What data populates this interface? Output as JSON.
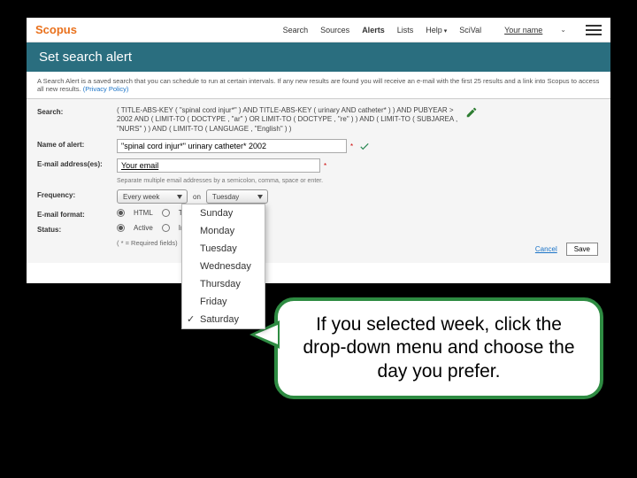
{
  "logo": "Scopus",
  "nav": {
    "search": "Search",
    "sources": "Sources",
    "alerts": "Alerts",
    "lists": "Lists",
    "help": "Help",
    "scival": "SciVal"
  },
  "user": {
    "name": "Your name"
  },
  "banner": {
    "title": "Set search alert"
  },
  "description": {
    "text": "A Search Alert is a saved search that you can schedule to run at certain intervals. If any new results are found you will receive an e-mail with the first 25 results and a link into Scopus to access all new results.",
    "privacy": "(Privacy Policy)"
  },
  "form": {
    "labels": {
      "search": "Search:",
      "name": "Name of alert:",
      "email": "E-mail address(es):",
      "frequency": "Frequency:",
      "format": "E-mail format:",
      "status": "Status:"
    },
    "search_query": "( TITLE-ABS-KEY ( \"spinal cord injur*\" )  AND  TITLE-ABS-KEY ( urinary  AND catheter* ) )  AND  PUBYEAR  >  2002  AND  ( LIMIT-TO ( DOCTYPE ,  \"ar\" )  OR  LIMIT-TO ( DOCTYPE ,  \"re\" ) )  AND  ( LIMIT-TO ( SUBJAREA ,  \"NURS\" ) )  AND  ( LIMIT-TO ( LANGUAGE ,  \"English\" ) )",
    "name_value": "\"spinal cord injur*\" urinary catheter* 2002",
    "email_value": "Your email",
    "email_helper": "Separate multiple email addresses by a semicolon, comma, space or enter.",
    "frequency_value": "Every week",
    "on": "on",
    "day_value": "Tuesday",
    "format_options": {
      "html": "HTML",
      "text": "Text"
    },
    "status_options": {
      "active": "Active",
      "inactive": "Inactive"
    },
    "required_note": "( * = Required fields)",
    "cancel": "Cancel",
    "save": "Save"
  },
  "days": {
    "items": [
      {
        "label": "Sunday",
        "selected": false
      },
      {
        "label": "Monday",
        "selected": false
      },
      {
        "label": "Tuesday",
        "selected": false
      },
      {
        "label": "Wednesday",
        "selected": false
      },
      {
        "label": "Thursday",
        "selected": false
      },
      {
        "label": "Friday",
        "selected": false
      },
      {
        "label": "Saturday",
        "selected": true
      }
    ]
  },
  "callout": {
    "text": "If you selected week, click the drop-down menu and choose the day you prefer."
  }
}
